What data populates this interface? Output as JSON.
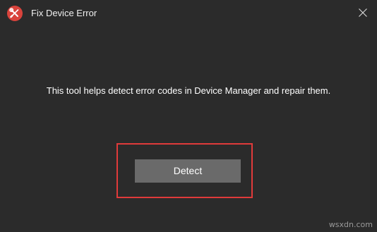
{
  "window": {
    "title": "Fix Device Error",
    "app_icon": "tools-icon",
    "close_icon": "close-icon"
  },
  "main": {
    "description": "This tool helps detect error codes in Device Manager and repair them.",
    "detect_label": "Detect"
  },
  "colors": {
    "background": "#2b2b2b",
    "button": "#6a6a6a",
    "highlight": "#e03a3a",
    "icon": "#d9433c"
  },
  "watermark": "wsxdn.com"
}
